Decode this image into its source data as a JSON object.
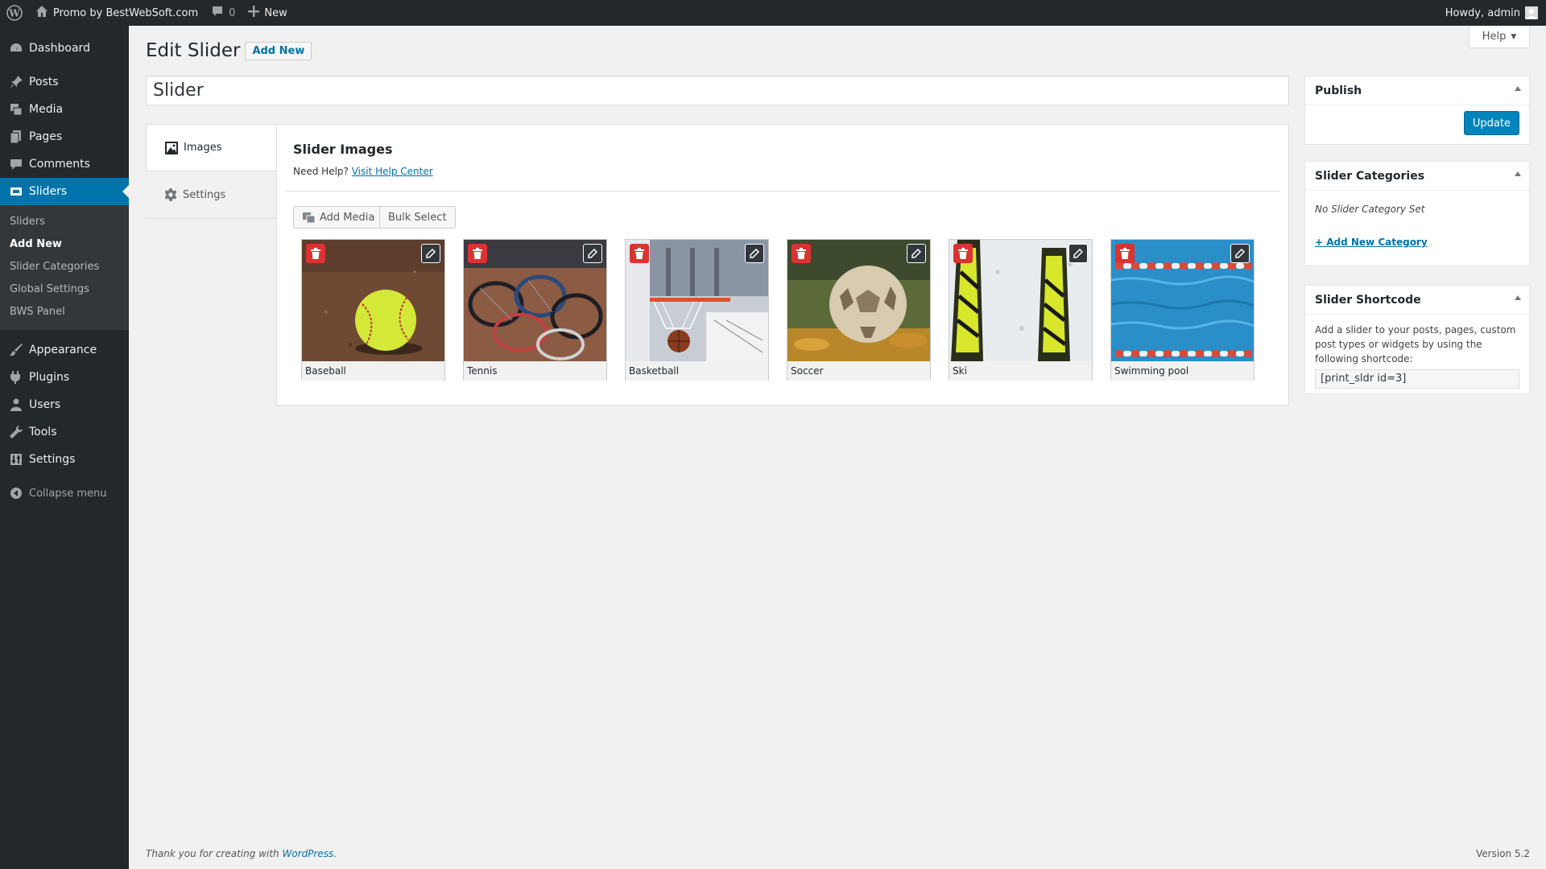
{
  "admin_bar": {
    "site_name": "Promo by BestWebSoft.com",
    "comments_count": "0",
    "new_label": "New",
    "greeting": "Howdy, admin"
  },
  "menu": {
    "dashboard": "Dashboard",
    "posts": "Posts",
    "media": "Media",
    "pages": "Pages",
    "comments": "Comments",
    "sliders": "Sliders",
    "submenu": [
      "Sliders",
      "Add New",
      "Slider Categories",
      "Global Settings",
      "BWS Panel"
    ],
    "appearance": "Appearance",
    "plugins": "Plugins",
    "users": "Users",
    "tools": "Tools",
    "settings": "Settings",
    "collapse": "Collapse menu"
  },
  "header": {
    "title": "Edit Slider",
    "add_new": "Add New",
    "help": "Help"
  },
  "title_field": {
    "value": "Slider"
  },
  "tabs": [
    "Images",
    "Settings"
  ],
  "panel": {
    "title": "Slider Images",
    "help_prefix": "Need Help?",
    "help_link": "Visit Help Center",
    "add_media": "Add Media",
    "bulk_select": "Bulk Select"
  },
  "images": [
    "Baseball",
    "Tennis",
    "Basketball",
    "Soccer",
    "Ski",
    "Swimming pool"
  ],
  "publish": {
    "title": "Publish",
    "update": "Update"
  },
  "categories": {
    "title": "Slider Categories",
    "none": "No Slider Category Set",
    "add_link": "+ Add New Category"
  },
  "shortcode": {
    "title": "Slider Shortcode",
    "description": "Add a slider to your posts, pages, custom post types or widgets by using the following shortcode:",
    "value": "[print_sldr id=3]"
  },
  "footer": {
    "text": "Thank you for creating with",
    "link": "WordPress",
    "period": ".",
    "version": "Version 5.2"
  },
  "colors": {
    "accent": "#0073aa",
    "delete": "#dc3232",
    "menu_bg": "#23282d"
  }
}
